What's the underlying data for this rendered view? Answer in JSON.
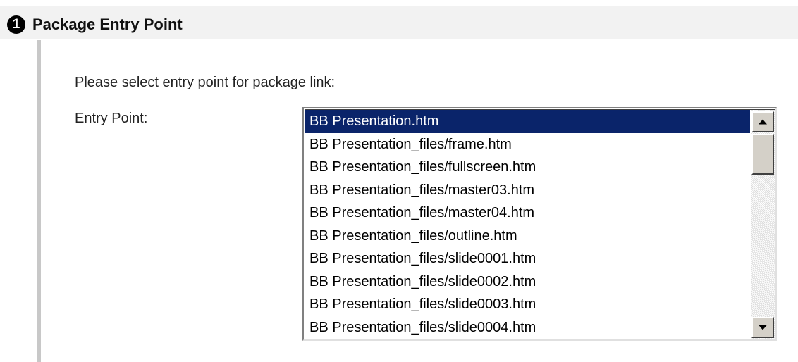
{
  "step": {
    "number": "1",
    "title": "Package Entry Point"
  },
  "form": {
    "instruction": "Please select entry point for package link:",
    "entry_point_label": "Entry Point:",
    "selected_value": "BB Presentation.htm",
    "options": [
      "BB Presentation.htm",
      "BB Presentation_files/frame.htm",
      "BB Presentation_files/fullscreen.htm",
      "BB Presentation_files/master03.htm",
      "BB Presentation_files/master04.htm",
      "BB Presentation_files/outline.htm",
      "BB Presentation_files/slide0001.htm",
      "BB Presentation_files/slide0002.htm",
      "BB Presentation_files/slide0003.htm",
      "BB Presentation_files/slide0004.htm"
    ]
  },
  "icons": {
    "step": "step-number-icon",
    "scroll_up": "scroll-up-arrow-icon",
    "scroll_down": "scroll-down-arrow-icon"
  },
  "colors": {
    "selection_background": "#0a246a",
    "selection_text": "#ffffff",
    "header_background": "#f2f2f2",
    "rail": "#c8c8c8"
  }
}
